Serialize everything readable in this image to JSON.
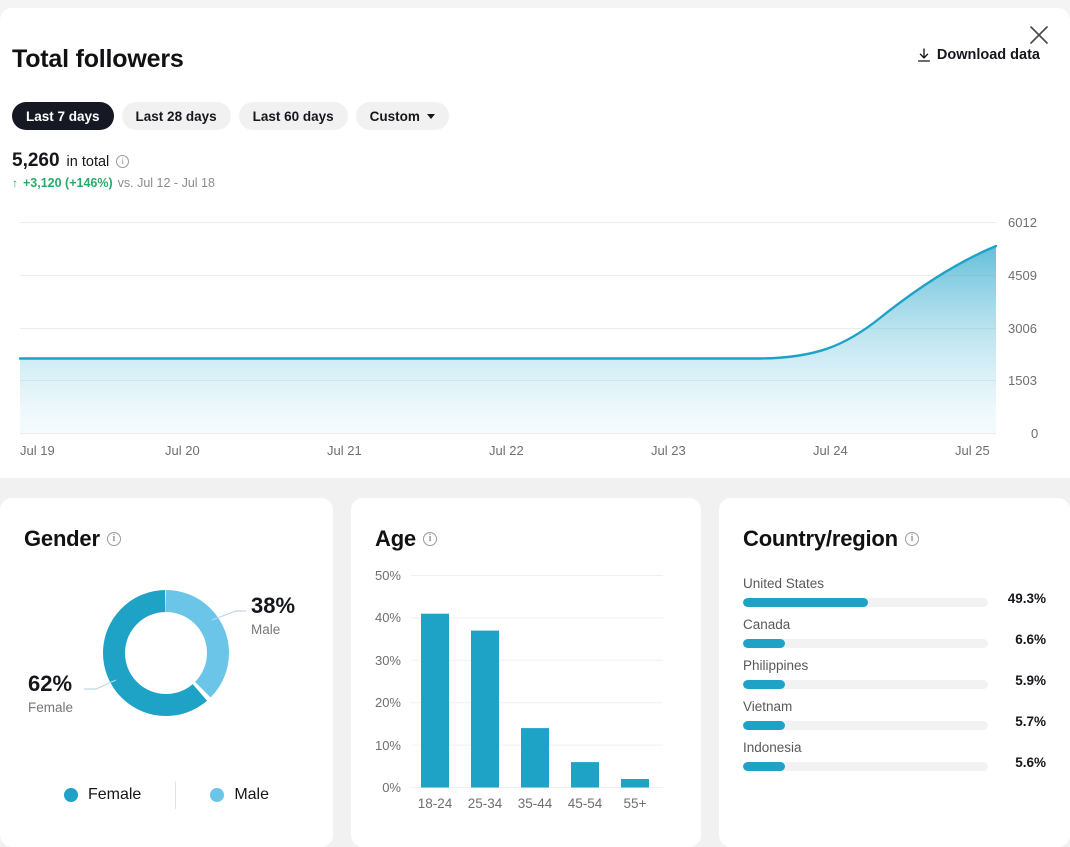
{
  "header": {
    "title": "Total followers",
    "download_label": "Download data",
    "download_icon": "download-icon",
    "close_icon": "close-icon"
  },
  "range_tabs": [
    {
      "label": "Last 7 days",
      "active": true
    },
    {
      "label": "Last 28 days",
      "active": false
    },
    {
      "label": "Last 60 days",
      "active": false
    },
    {
      "label": "Custom",
      "active": false,
      "has_caret": true
    }
  ],
  "summary": {
    "value": "5,260",
    "label": "in total",
    "info_icon": "info-icon",
    "delta_arrow": "↑",
    "delta": "+3,120 (+146%)",
    "comparison": "vs. Jul 12 - Jul 18"
  },
  "colors": {
    "accent_teal": "#1ea2c6",
    "accent_light_blue": "#6bc5e9",
    "positive_green": "#2aa96a",
    "active_pill_bg": "#161823"
  },
  "chart_data": [
    {
      "type": "area",
      "id": "total-followers-trend",
      "title": "Total followers",
      "xlabel": "",
      "ylabel": "",
      "x": [
        "Jul 19",
        "Jul 20",
        "Jul 21",
        "Jul 22",
        "Jul 23",
        "Jul 24",
        "Jul 25"
      ],
      "values": [
        2140,
        2140,
        2142,
        2143,
        2145,
        2150,
        5260
      ],
      "y_ticks": [
        0,
        1503,
        3006,
        4509,
        6012
      ],
      "y_tick_labels": [
        "0",
        "1503",
        "3006",
        "4509",
        "6012"
      ],
      "ylim": [
        0,
        6012
      ],
      "grid": true,
      "legend": "none",
      "line_color": "#1ea2c6",
      "fill": "gradient teal to white"
    },
    {
      "type": "pie",
      "id": "gender-donut",
      "title": "Gender",
      "labels": [
        "Female",
        "Male"
      ],
      "values": [
        62,
        38
      ],
      "value_labels": [
        "62%",
        "38%"
      ],
      "colors": [
        "#1ea2c6",
        "#6bc5e9"
      ],
      "legend": "bottom",
      "donut": true
    },
    {
      "type": "bar",
      "id": "age-bars",
      "title": "Age",
      "categories": [
        "18-24",
        "25-34",
        "35-44",
        "45-54",
        "55+"
      ],
      "values": [
        41,
        37,
        14,
        6,
        2
      ],
      "xlabel": "",
      "ylabel": "",
      "ylim": [
        0,
        50
      ],
      "y_ticks": [
        0,
        10,
        20,
        30,
        40,
        50
      ],
      "y_tick_labels": [
        "0%",
        "10%",
        "20%",
        "30%",
        "40%",
        "50%"
      ],
      "grid": true,
      "bar_color": "#1ea2c6"
    },
    {
      "type": "bar",
      "id": "country-region-bars",
      "title": "Country/region",
      "orientation": "horizontal",
      "categories": [
        "United States",
        "Canada",
        "Philippines",
        "Vietnam",
        "Indonesia"
      ],
      "values": [
        49.3,
        6.6,
        5.9,
        5.7,
        5.6
      ],
      "value_labels": [
        "49.3%",
        "6.6%",
        "5.9%",
        "5.7%",
        "5.6%"
      ],
      "bar_color": "#1ea2c6",
      "track_color": "#f2f2f3",
      "scale_max": 97
    }
  ],
  "cards": {
    "gender": {
      "title": "Gender",
      "info_icon": "info-icon",
      "callouts": [
        {
          "pct": "62%",
          "name": "Female"
        },
        {
          "pct": "38%",
          "name": "Male"
        }
      ],
      "legend": [
        {
          "label": "Female",
          "color": "#1ea2c6"
        },
        {
          "label": "Male",
          "color": "#6bc5e9"
        }
      ]
    },
    "age": {
      "title": "Age",
      "info_icon": "info-icon"
    },
    "country": {
      "title": "Country/region",
      "info_icon": "info-icon",
      "rows": [
        {
          "name": "United States",
          "pct": "49.3%",
          "width": 51
        },
        {
          "name": "Canada",
          "pct": "6.6%",
          "width": 17
        },
        {
          "name": "Philippines",
          "pct": "5.9%",
          "width": 17
        },
        {
          "name": "Vietnam",
          "pct": "5.7%",
          "width": 17
        },
        {
          "name": "Indonesia",
          "pct": "5.6%",
          "width": 17
        }
      ]
    }
  }
}
